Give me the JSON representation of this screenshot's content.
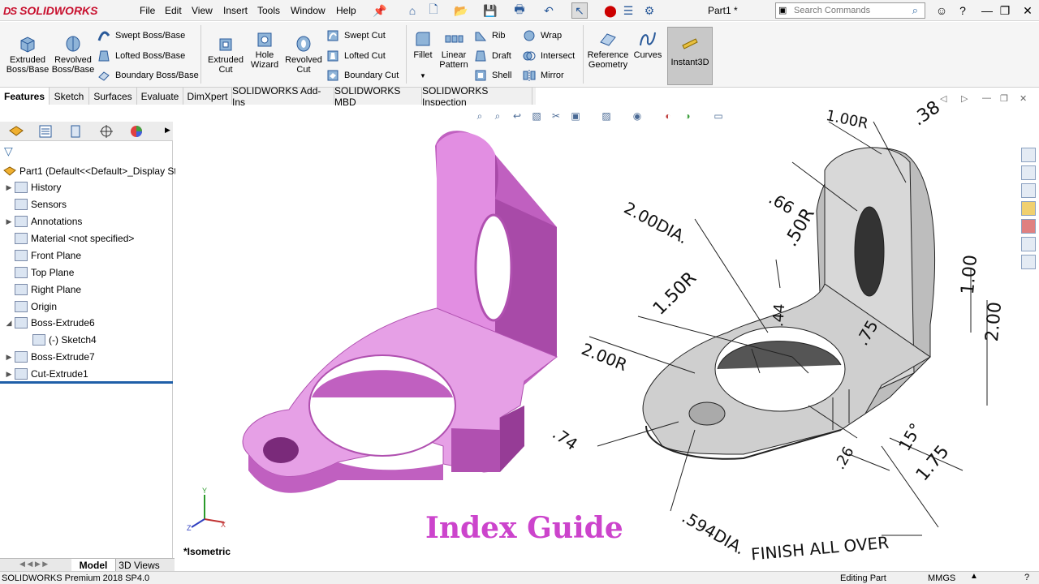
{
  "app": {
    "brand": "SOLIDWORKS",
    "brand_prefix": "DS"
  },
  "menu": [
    "File",
    "Edit",
    "View",
    "Insert",
    "Tools",
    "Window",
    "Help"
  ],
  "document_title": "Part1 *",
  "search": {
    "placeholder": "Search Commands"
  },
  "ribbon": {
    "extruded_boss": "Extruded\nBoss/Base",
    "revolved_boss": "Revolved\nBoss/Base",
    "swept_boss": "Swept Boss/Base",
    "lofted_boss": "Lofted Boss/Base",
    "boundary_boss": "Boundary Boss/Base",
    "extruded_cut": "Extruded\nCut",
    "hole_wizard": "Hole\nWizard",
    "revolved_cut": "Revolved\nCut",
    "swept_cut": "Swept Cut",
    "lofted_cut": "Lofted Cut",
    "boundary_cut": "Boundary Cut",
    "fillet": "Fillet",
    "linear_pattern": "Linear\nPattern",
    "rib": "Rib",
    "draft": "Draft",
    "shell": "Shell",
    "wrap": "Wrap",
    "intersect": "Intersect",
    "mirror": "Mirror",
    "reference_geometry": "Reference\nGeometry",
    "curves": "Curves",
    "instant3d": "Instant3D"
  },
  "tabs": [
    "Features",
    "Sketch",
    "Surfaces",
    "Evaluate",
    "DimXpert",
    "SOLIDWORKS Add-Ins",
    "SOLIDWORKS MBD",
    "SOLIDWORKS Inspection"
  ],
  "tree": {
    "root": "Part1  (Default<<Default>_Display Stat",
    "items": [
      {
        "label": "History",
        "expandable": true
      },
      {
        "label": "Sensors",
        "expandable": false
      },
      {
        "label": "Annotations",
        "expandable": true
      },
      {
        "label": "Material <not specified>",
        "expandable": false
      },
      {
        "label": "Front Plane",
        "expandable": false
      },
      {
        "label": "Top Plane",
        "expandable": false
      },
      {
        "label": "Right Plane",
        "expandable": false
      },
      {
        "label": "Origin",
        "expandable": false
      },
      {
        "label": "Boss-Extrude6",
        "expandable": true,
        "expanded": true
      },
      {
        "label": "(-) Sketch4",
        "expandable": false,
        "child": true
      },
      {
        "label": "Boss-Extrude7",
        "expandable": true
      },
      {
        "label": "Cut-Extrude1",
        "expandable": true
      }
    ]
  },
  "bottom_tabs": [
    "Model",
    "3D Views"
  ],
  "view_label": "*Isometric",
  "overlay_title": "Index Guide",
  "drawing": {
    "dims": [
      "1.00R",
      ".38",
      ".66",
      "2.00DIA.",
      ".50R",
      "1.50R",
      ".44",
      ".75",
      "1.00",
      "2.00",
      "2.00R",
      ".74",
      ".26",
      "15°",
      "1.75",
      ".594DIA."
    ],
    "note": "FINISH ALL OVER"
  },
  "status": {
    "product": "SOLIDWORKS Premium 2018 SP4.0",
    "mode": "Editing Part",
    "units": "MMGS"
  },
  "colors": {
    "part": "#d67ed6",
    "accent": "#1f5fa8",
    "brand": "#c8102e",
    "overlay": "#cc44cc"
  }
}
